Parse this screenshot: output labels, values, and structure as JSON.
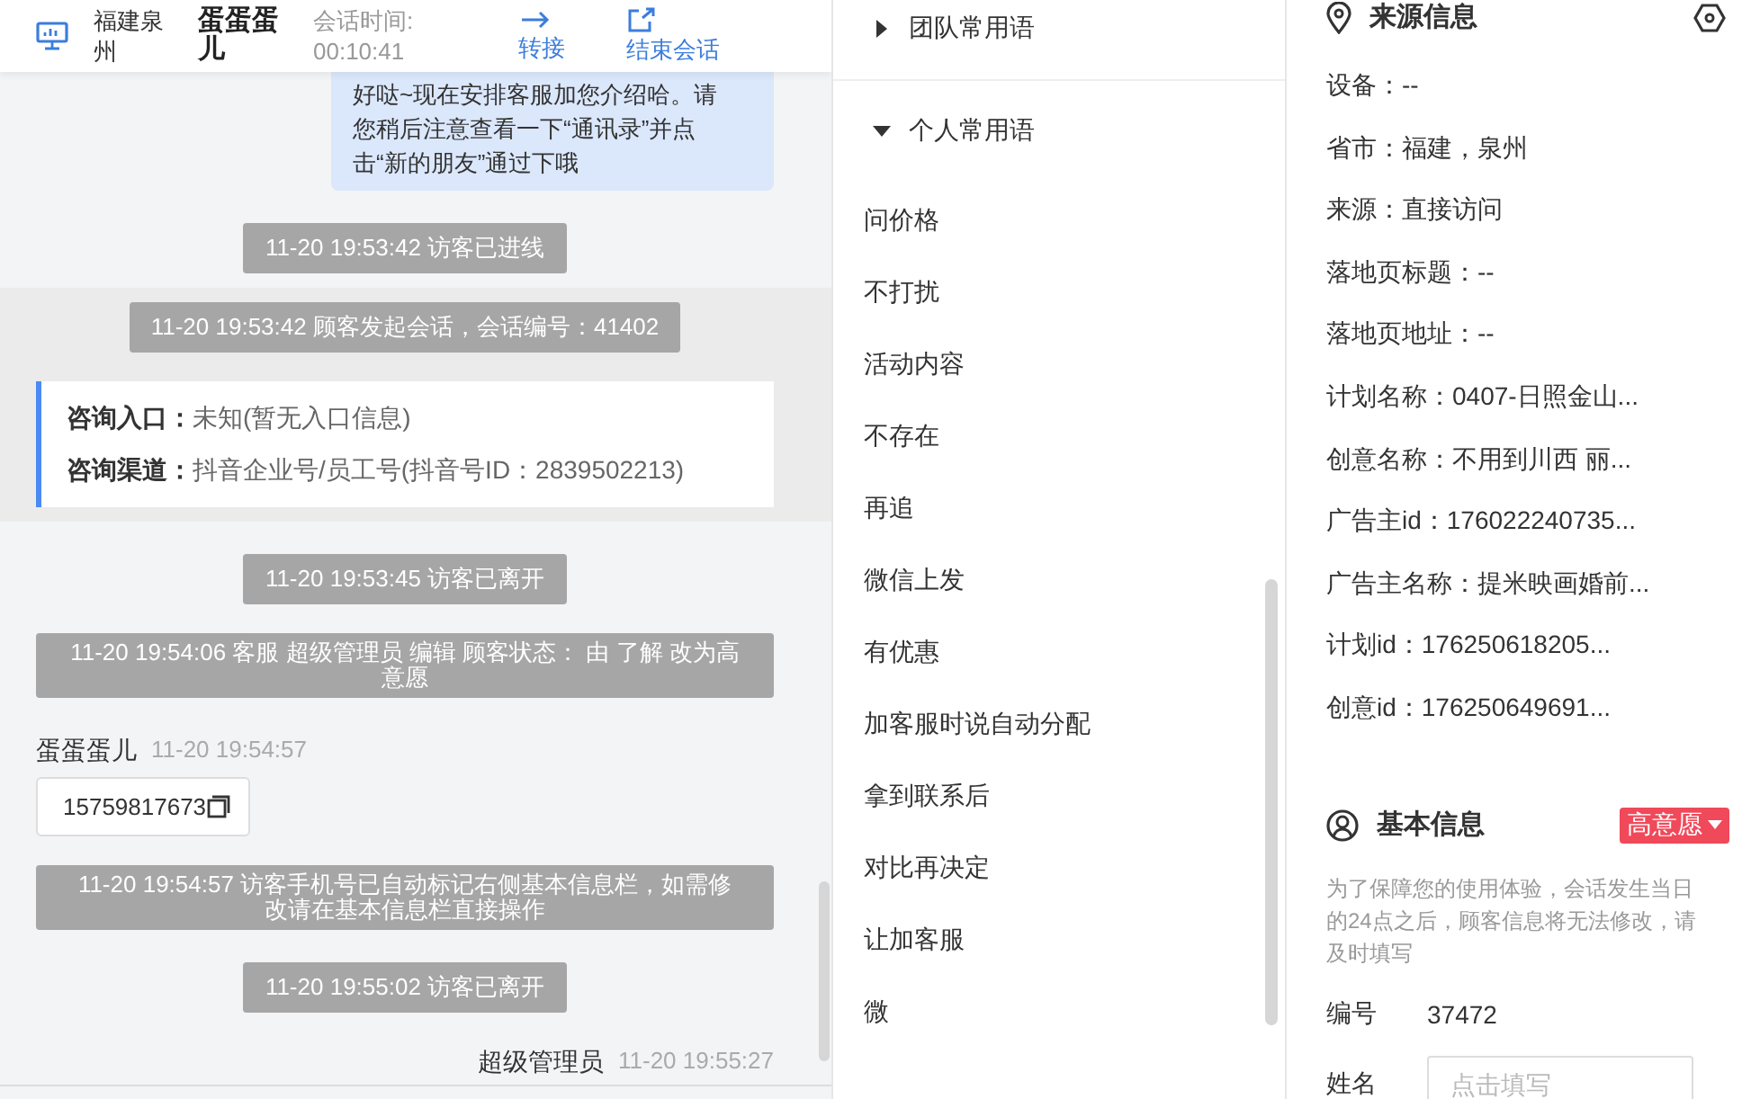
{
  "header": {
    "location": "福建泉州",
    "visitor": "蛋蛋蛋儿",
    "duration_label": "会话时间:",
    "duration": "00:10:41",
    "actions": [
      {
        "label": "转接",
        "kind": "transfer"
      },
      {
        "label": "结束会话",
        "kind": "end"
      }
    ]
  },
  "chat": {
    "messages": [
      {
        "kind": "bubble",
        "text": "好哒~现在安排客服加您介绍哈。请您稍后注意查看一下“通讯录”并点击“新的朋友”通过下哦"
      },
      {
        "kind": "system",
        "text": "11-20 19:53:42 访客已进线"
      },
      {
        "kind": "session",
        "text": "11-20 19:53:42 顾客发起会话，会话编号：41402",
        "entries": [
          {
            "label": "咨询入口：",
            "value": "未知(暂无入口信息)"
          },
          {
            "label": "咨询渠道：",
            "value": "抖音企业号/员工号(抖音号ID：2839502213)"
          }
        ]
      },
      {
        "kind": "system",
        "text": "11-20 19:53:45 访客已离开"
      },
      {
        "kind": "notice",
        "text": "11-20 19:54:06 客服 超级管理员 编辑 顾客状态： 由 了解 改为高意愿"
      },
      {
        "kind": "visitor",
        "sender": "蛋蛋蛋儿",
        "time": "11-20 19:54:57",
        "text": "15759817673"
      },
      {
        "kind": "notice",
        "text": "11-20 19:54:57 访客手机号已自动标记右侧基本信息栏，如需修改请在基本信息栏直接操作"
      },
      {
        "kind": "system",
        "text": "11-20 19:55:02 访客已离开"
      },
      {
        "kind": "agent",
        "sender": "超级管理员",
        "time": "11-20 19:55:27"
      }
    ]
  },
  "phrases": {
    "groups": [
      {
        "title": "团队常用语",
        "expanded": false
      },
      {
        "title": "个人常用语",
        "expanded": true,
        "items": [
          "问价格",
          "不打扰",
          "活动内容",
          "不存在",
          "再追",
          "微信上发",
          "有优惠",
          "加客服时说自动分配",
          "拿到联系后",
          "对比再决定",
          "让加客服",
          "微"
        ]
      }
    ]
  },
  "source_info": {
    "title": "来源信息",
    "rows": [
      "设备：--",
      "省市：福建，泉州",
      "来源：直接访问",
      "落地页标题：--",
      "落地页地址：--",
      "计划名称：0407-日照金山...",
      "创意名称：不用到川西 丽...",
      "广告主id：176022240735...",
      "广告主名称：提米映画婚前...",
      "计划id：176250618205...",
      "创意id：176250649691..."
    ]
  },
  "basic_info": {
    "title": "基本信息",
    "intent": "高意愿",
    "note": "为了保障您的使用体验，会话发生当日的24点之后，顾客信息将无法修改，请及时填写",
    "fields": [
      {
        "kind": "text",
        "label": "编号",
        "value": "37472"
      },
      {
        "kind": "input",
        "label": "姓名",
        "placeholder": "点击填写"
      }
    ]
  }
}
